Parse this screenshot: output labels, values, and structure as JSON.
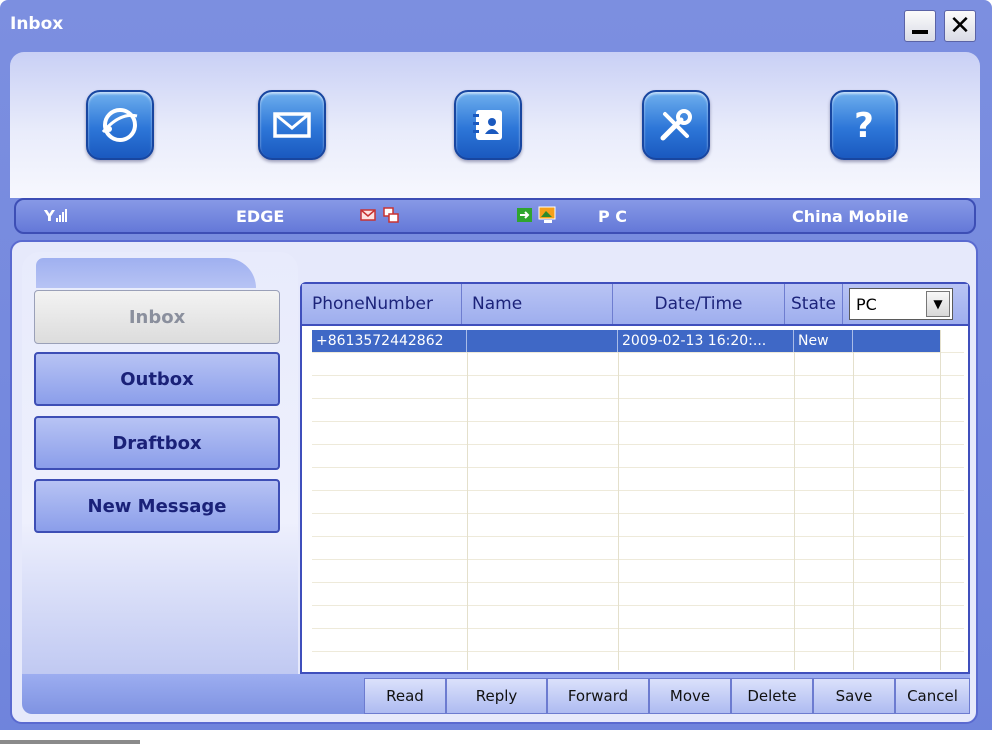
{
  "window": {
    "title": "Inbox",
    "minimize_label": "_",
    "close_label": "✕"
  },
  "toolbar": {
    "buttons": [
      {
        "name": "internet",
        "icon": "globe-icon"
      },
      {
        "name": "sms",
        "icon": "envelope-icon"
      },
      {
        "name": "phonebook",
        "icon": "contacts-book-icon"
      },
      {
        "name": "settings",
        "icon": "tools-icon"
      },
      {
        "name": "help",
        "icon": "help-icon"
      }
    ]
  },
  "status": {
    "network_type": "EDGE",
    "connection": "P C",
    "operator": "China Mobile",
    "signal_icon": "signal-strength-icon"
  },
  "sidebar": {
    "items": [
      {
        "label": "Inbox",
        "active": true
      },
      {
        "label": "Outbox",
        "active": false
      },
      {
        "label": "Draftbox",
        "active": false
      },
      {
        "label": "New Message",
        "active": false
      }
    ]
  },
  "grid": {
    "columns": [
      "PhoneNumber",
      "Name",
      "Date/Time",
      "State"
    ],
    "filter_value": "PC",
    "rows": [
      {
        "phone": "+8613572442862",
        "name": "",
        "datetime": "2009-02-13 16:20:...",
        "state": "New",
        "selected": true
      }
    ]
  },
  "actions": [
    "Read",
    "Reply",
    "Forward",
    "Move",
    "Delete",
    "Save",
    "Cancel"
  ],
  "colors": {
    "accent": "#2d76d8",
    "selected_row": "#3f68c6",
    "frame": "#6f84dc"
  }
}
